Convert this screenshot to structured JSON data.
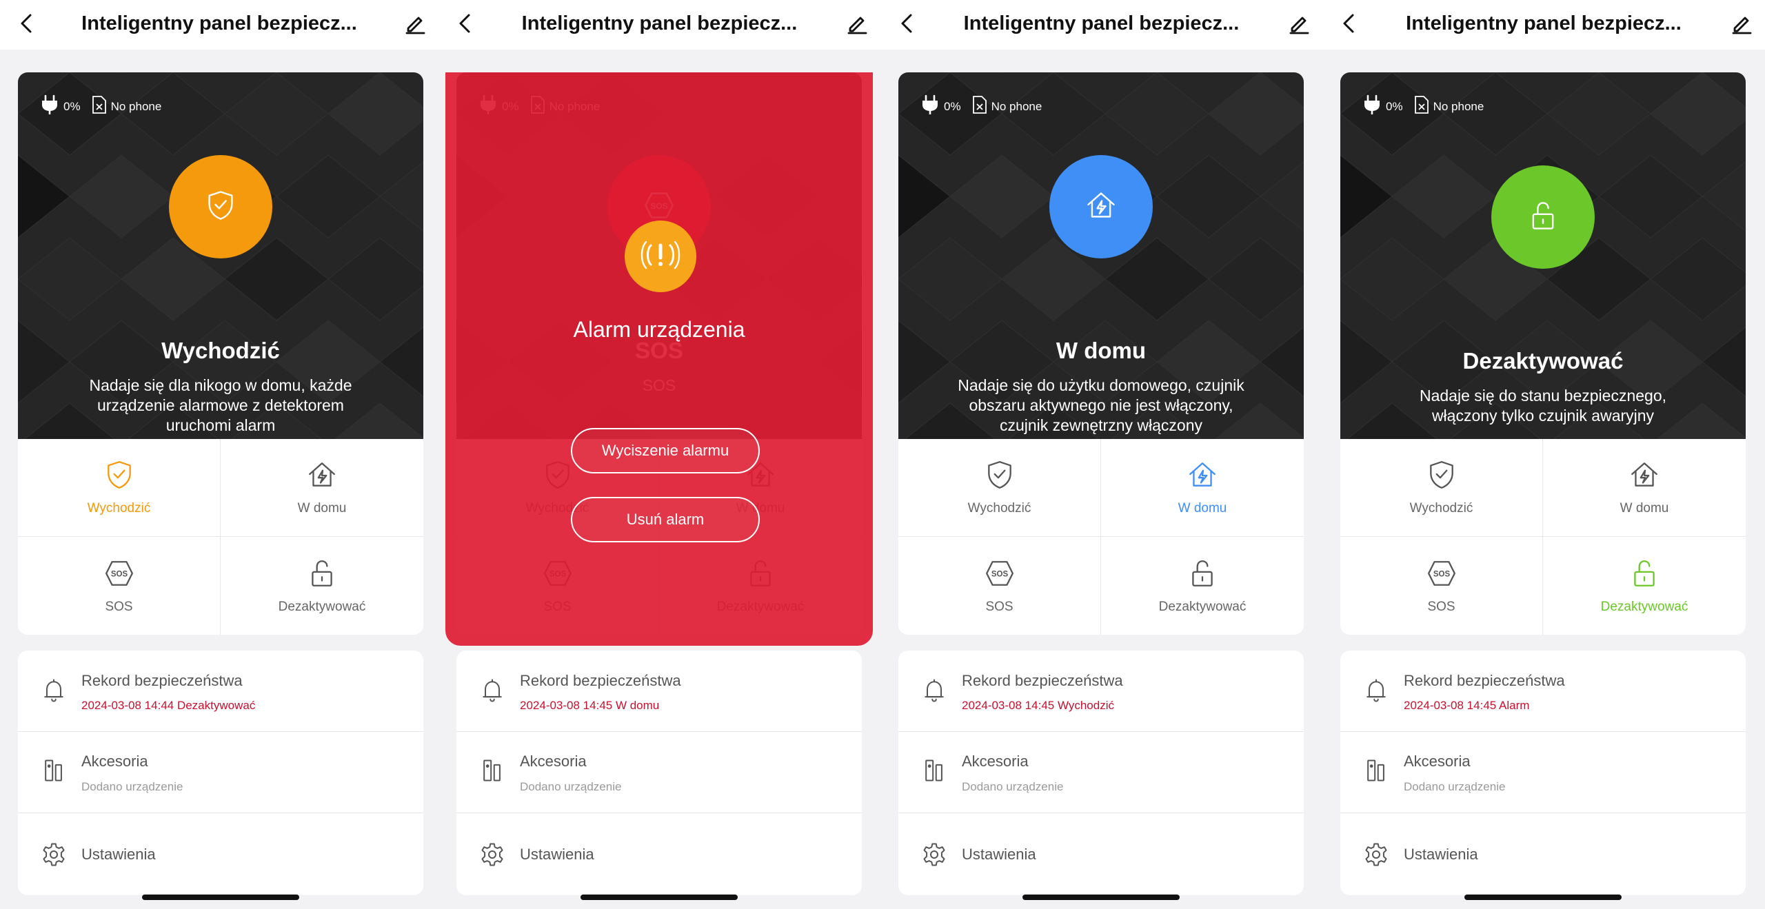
{
  "colors": {
    "away": "#f49a0c",
    "home": "#3f8ff7",
    "disarm": "#6cc72a",
    "alarm_red": "#de1c32",
    "record_red": "#c8102e",
    "hero_bg": "#262626"
  },
  "panels": [
    {
      "title": "Inteligentny panel bezpiecz...",
      "status": {
        "battery": "0%",
        "phone": "No phone"
      },
      "mode": {
        "icon": "shield-check-icon",
        "title": "Wychodzić",
        "description": "Nadaje się dla nikogo w domu, każde urządzenie alarmowe z detektorem uruchomi alarm"
      },
      "buttons": [
        {
          "label": "Wychodzić",
          "icon": "shield-check-icon"
        },
        {
          "label": "W domu",
          "icon": "home-bolt-icon"
        },
        {
          "label": "SOS",
          "icon": "sos-icon"
        },
        {
          "label": "Dezaktywować",
          "icon": "unlock-icon"
        }
      ],
      "active_button": 0,
      "records": {
        "title": "Rekord bezpieczeństwa",
        "subtitle": "2024-03-08 14:44 Dezaktywować"
      },
      "accessories": {
        "title": "Akcesoria",
        "subtitle": "Dodano urządzenie"
      },
      "settings": {
        "title": "Ustawienia"
      }
    },
    {
      "title": "Inteligentny panel bezpiecz...",
      "status": {
        "battery": "0%",
        "phone": "No phone"
      },
      "mode": {
        "icon": "sos-icon",
        "title": "SOS",
        "description": "SOS"
      },
      "buttons": [
        {
          "label": "Wychodzić",
          "icon": "shield-check-icon"
        },
        {
          "label": "W domu",
          "icon": "home-bolt-icon"
        },
        {
          "label": "SOS",
          "icon": "sos-icon"
        },
        {
          "label": "Dezaktywować",
          "icon": "unlock-icon"
        }
      ],
      "active_button": -1,
      "alarm": {
        "title": "Alarm urządzenia",
        "icon": "alarm-siren-icon",
        "silence_label": "Wyciszenie alarmu",
        "clear_label": "Usuń alarm"
      },
      "records": {
        "title": "Rekord bezpieczeństwa",
        "subtitle": "2024-03-08 14:45 W domu"
      },
      "accessories": {
        "title": "Akcesoria",
        "subtitle": "Dodano urządzenie"
      },
      "settings": {
        "title": "Ustawienia"
      }
    },
    {
      "title": "Inteligentny panel bezpiecz...",
      "status": {
        "battery": "0%",
        "phone": "No phone"
      },
      "mode": {
        "icon": "home-bolt-icon",
        "title": "W domu",
        "description": "Nadaje się do użytku domowego, czujnik obszaru aktywnego nie jest włączony, czujnik zewnętrzny włączony"
      },
      "buttons": [
        {
          "label": "Wychodzić",
          "icon": "shield-check-icon"
        },
        {
          "label": "W domu",
          "icon": "home-bolt-icon"
        },
        {
          "label": "SOS",
          "icon": "sos-icon"
        },
        {
          "label": "Dezaktywować",
          "icon": "unlock-icon"
        }
      ],
      "active_button": 1,
      "records": {
        "title": "Rekord bezpieczeństwa",
        "subtitle": "2024-03-08 14:45 Wychodzić"
      },
      "accessories": {
        "title": "Akcesoria",
        "subtitle": "Dodano urządzenie"
      },
      "settings": {
        "title": "Ustawienia"
      }
    },
    {
      "title": "Inteligentny panel bezpiecz...",
      "status": {
        "battery": "0%",
        "phone": "No phone"
      },
      "mode": {
        "icon": "unlock-icon",
        "title": "Dezaktywować",
        "description": "Nadaje się do stanu bezpiecznego, włączony tylko czujnik awaryjny"
      },
      "buttons": [
        {
          "label": "Wychodzić",
          "icon": "shield-check-icon"
        },
        {
          "label": "W domu",
          "icon": "home-bolt-icon"
        },
        {
          "label": "SOS",
          "icon": "sos-icon"
        },
        {
          "label": "Dezaktywować",
          "icon": "unlock-icon"
        }
      ],
      "active_button": 3,
      "records": {
        "title": "Rekord bezpieczeństwa",
        "subtitle": "2024-03-08 14:45 Alarm"
      },
      "accessories": {
        "title": "Akcesoria",
        "subtitle": "Dodano urządzenie"
      },
      "settings": {
        "title": "Ustawienia"
      }
    }
  ]
}
